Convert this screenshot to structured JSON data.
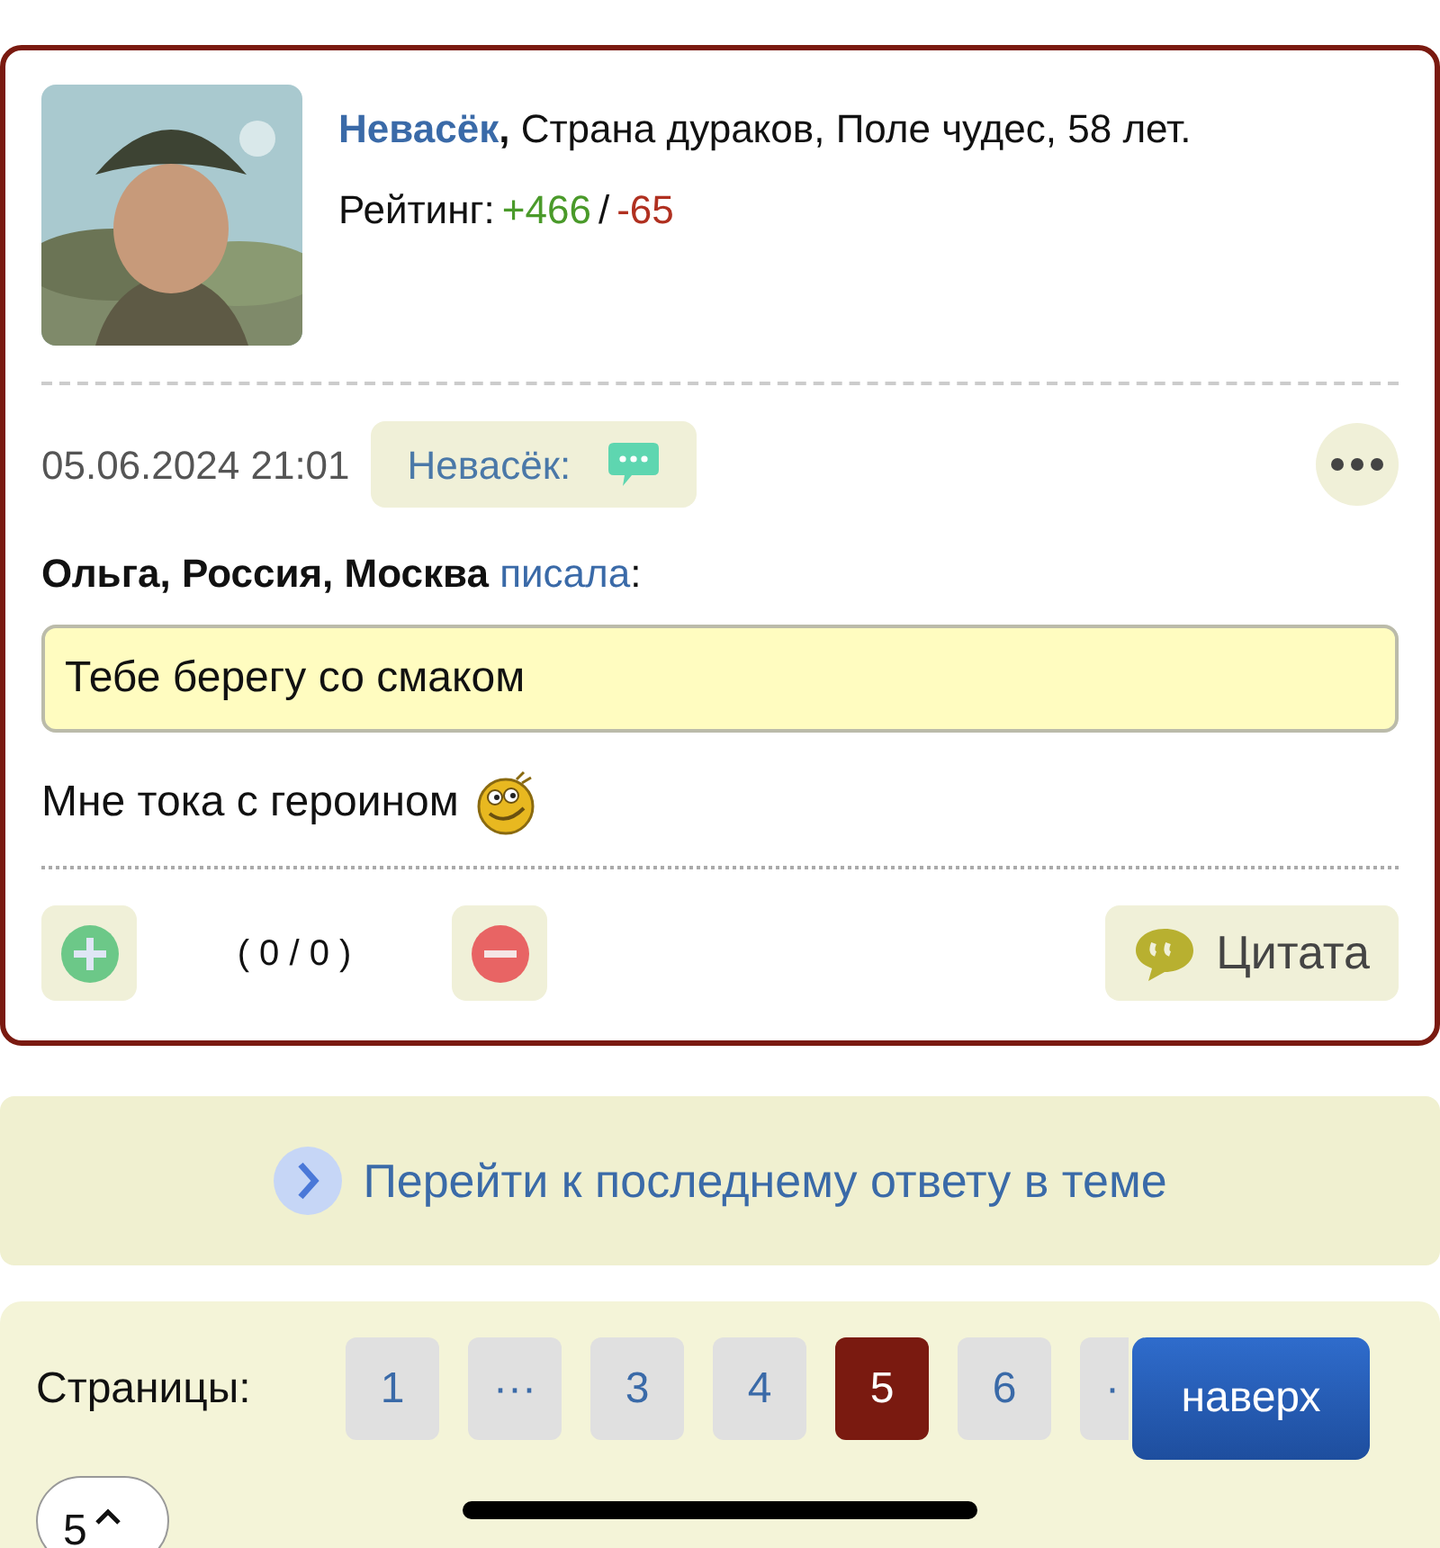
{
  "author": {
    "name": "Невасёк",
    "name_punct": ",",
    "details": " Страна дураков, Поле чудес, 58 лет.",
    "rating_label": "Рейтинг:",
    "rating_plus": "+466",
    "rating_separator": "/",
    "rating_minus": "-65"
  },
  "post": {
    "datetime": "05.06.2024 21:01",
    "reply_to": "Невасёк:",
    "quote_author": "Ольга, Россия, Москва",
    "quote_verb": "писала",
    "quote_colon": ":",
    "quote_text": "Тебе берегу со смаком",
    "message": "Мне тока с героином",
    "votes": "( 0 / 0 )",
    "quote_button": "Цитата"
  },
  "last_reply_link": "Перейти к последнему ответу в теме",
  "pagination": {
    "label": "Страницы:",
    "pages": [
      {
        "label": "1",
        "selected": false
      },
      {
        "label": "···",
        "selected": false
      },
      {
        "label": "3",
        "selected": false
      },
      {
        "label": "4",
        "selected": false
      },
      {
        "label": "5",
        "selected": true
      },
      {
        "label": "6",
        "selected": false
      },
      {
        "label": "·",
        "selected": false
      }
    ],
    "select_value": "5"
  },
  "scroll_top_button": "наверх"
}
